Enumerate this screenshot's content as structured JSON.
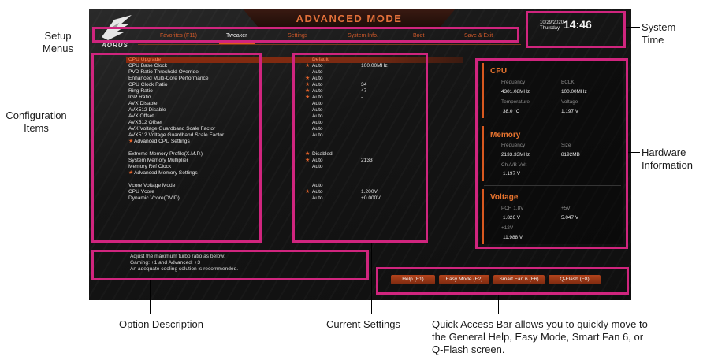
{
  "header": {
    "mode_title": "ADVANCED MODE",
    "brand": "AORUS",
    "date_line1": "10/29/2020",
    "date_line2": "Thursday",
    "time": "14:46"
  },
  "menu": [
    {
      "label": "Favorites (F11)"
    },
    {
      "label": "Tweaker"
    },
    {
      "label": "Settings"
    },
    {
      "label": "System Info."
    },
    {
      "label": "Boot"
    },
    {
      "label": "Save & Exit"
    }
  ],
  "items": [
    {
      "label": "CPU Upgrade",
      "value": "Default",
      "detail": "",
      "star": false
    },
    {
      "label": "CPU Base Clock",
      "value": "Auto",
      "detail": "100.00MHz",
      "star": true
    },
    {
      "label": "PVD Ratio Threshold Override",
      "value": "Auto",
      "detail": "-",
      "star": false
    },
    {
      "label": "Enhanced Multi-Core Performance",
      "value": "Auto",
      "detail": "",
      "star": true
    },
    {
      "label": "CPU Clock Ratio",
      "value": "Auto",
      "detail": "34",
      "star": true
    },
    {
      "label": "Ring Ratio",
      "value": "Auto",
      "detail": "47",
      "star": true
    },
    {
      "label": "IGP Ratio",
      "value": "Auto",
      "detail": "-",
      "star": true
    },
    {
      "label": "AVX Disable",
      "value": "Auto",
      "detail": "",
      "star": false
    },
    {
      "label": "AVX512 Disable",
      "value": "Auto",
      "detail": "",
      "star": false
    },
    {
      "label": "AVX Offset",
      "value": "Auto",
      "detail": "",
      "star": false
    },
    {
      "label": "AVX512 Offset",
      "value": "Auto",
      "detail": "",
      "star": false
    },
    {
      "label": "AVX Voltage Guardband Scale Factor",
      "value": "Auto",
      "detail": "",
      "star": false
    },
    {
      "label": "AVX512 Voltage Guardband Scale Factor",
      "value": "Auto",
      "detail": "",
      "star": false
    },
    {
      "label": "Advanced CPU Settings",
      "value": "",
      "detail": "",
      "star": false,
      "sub": true
    },
    {
      "label": "",
      "value": "",
      "detail": "",
      "star": false
    },
    {
      "label": "Extreme Memory Profile(X.M.P.)",
      "value": "Disabled",
      "detail": "",
      "star": true
    },
    {
      "label": "System Memory Multiplier",
      "value": "Auto",
      "detail": "2133",
      "star": true
    },
    {
      "label": "Memory Ref Clock",
      "value": "Auto",
      "detail": "",
      "star": false
    },
    {
      "label": "Advanced Memory Settings",
      "value": "",
      "detail": "",
      "star": false,
      "sub": true
    },
    {
      "label": "",
      "value": "",
      "detail": "",
      "star": false
    },
    {
      "label": "Vcore Voltage Mode",
      "value": "Auto",
      "detail": "",
      "star": false
    },
    {
      "label": "CPU Vcore",
      "value": "Auto",
      "detail": "1.200V",
      "star": true
    },
    {
      "label": "Dynamic Vcore(DVID)",
      "value": "Auto",
      "detail": "+0.000V",
      "star": false
    }
  ],
  "description": [
    "Adjust the maximum turbo ratio as below:",
    "Gaming: +1 and Advanced: +3",
    "An adequate cooling solution is recommended."
  ],
  "hardware": {
    "cpu": {
      "title": "CPU",
      "freq_label": "Frequency",
      "freq_value": "4301.08MHz",
      "bclk_label": "BCLK",
      "bclk_value": "100.00MHz",
      "temp_label": "Temperature",
      "temp_value": "38.0 °C",
      "volt_label": "Voltage",
      "volt_value": "1.197 V"
    },
    "memory": {
      "title": "Memory",
      "freq_label": "Frequency",
      "freq_value": "2133.33MHz",
      "size_label": "Size",
      "size_value": "8192MB",
      "chvolt_label": "Ch A/B Volt",
      "chvolt_value": "1.197 V"
    },
    "voltage": {
      "title": "Voltage",
      "pch_label": "PCH 1.8V",
      "pch_value": "1.826 V",
      "v5_label": "+5V",
      "v5_value": "5.047 V",
      "v12_label": "+12V",
      "v12_value": "11.988 V"
    }
  },
  "quick_access": [
    {
      "label": "Help (F1)"
    },
    {
      "label": "Easy Mode (F2)"
    },
    {
      "label": "Smart Fan 6 (F6)"
    },
    {
      "label": "Q-Flash (F8)"
    }
  ],
  "annotations": {
    "setup_menus": [
      "Setup",
      "Menus"
    ],
    "configuration_items": [
      "Configuration",
      "Items"
    ],
    "system_time": [
      "System",
      "Time"
    ],
    "hardware_information": [
      "Hardware",
      "Information"
    ],
    "option_description": "Option Description",
    "current_settings": "Current Settings",
    "quick_access_bar": [
      "Quick Access Bar allows you to quickly move to",
      "the General Help, Easy Mode, Smart Fan 6, or",
      "Q-Flash screen."
    ]
  },
  "colors": {
    "accent": "#e05a1a",
    "annotation_box": "#d0257e",
    "menu_text": "#d25a2a"
  }
}
